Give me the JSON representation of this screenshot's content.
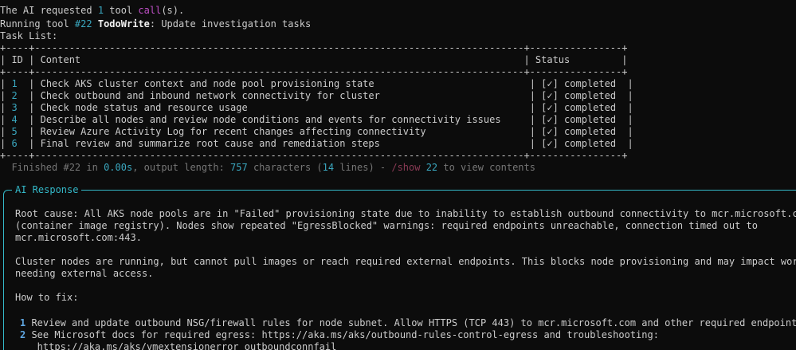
{
  "header": {
    "requested_prefix": "The AI requested ",
    "requested_count": "1",
    "requested_mid": " tool ",
    "requested_call": "call",
    "requested_suffix": "(s).",
    "running_prefix": "Running tool ",
    "running_id": "#22",
    "running_tool": "TodoWrite",
    "running_suffix": ": Update investigation tasks",
    "task_list_label": "Task List:"
  },
  "table": {
    "border_top": "+----+-------------------------------------------------------------------------------------+----------------+",
    "header_row": "| ID | Content                                                                             | Status         |",
    "border_mid": "+----+-------------------------------------------------------------------------------------+----------------+",
    "border_bottom": "+----+-------------------------------------------------------------------------------------+----------------+",
    "rows": [
      {
        "id": "1",
        "content": "Check AKS cluster context and node pool provisioning state",
        "status": "[✓] completed"
      },
      {
        "id": "2",
        "content": "Check outbound and inbound network connectivity for cluster",
        "status": "[✓] completed"
      },
      {
        "id": "3",
        "content": "Check node status and resource usage",
        "status": "[✓] completed"
      },
      {
        "id": "4",
        "content": "Describe all nodes and review node conditions and events for connectivity issues",
        "status": "[✓] completed"
      },
      {
        "id": "5",
        "content": "Review Azure Activity Log for recent changes affecting connectivity",
        "status": "[✓] completed"
      },
      {
        "id": "6",
        "content": "Final review and summarize root cause and remediation steps",
        "status": "[✓] completed"
      }
    ]
  },
  "finished": {
    "prefix": "  Finished ",
    "id": "#22",
    "in": " in ",
    "time": "0.00s",
    "output": ", output length: ",
    "length": "757",
    "characters": " characters (",
    "lines": "14",
    "lines_suffix": " lines) - ",
    "show_cmd": "/show",
    "show_num": " 22",
    "view": " to view contents"
  },
  "response": {
    "title": "AI Response",
    "lines": [
      "Root cause: All AKS node pools are in \"Failed\" provisioning state due to inability to establish outbound connectivity to mcr.microsoft.com",
      "(container image registry). Nodes show repeated \"EgressBlocked\" warnings: required endpoints unreachable, connection timed out to",
      "mcr.microsoft.com:443.",
      "",
      "Cluster nodes are running, but cannot pull images or reach required external endpoints. This blocks node provisioning and may impact workloads",
      "needing external access.",
      "",
      "How to fix:",
      ""
    ],
    "fix_items": [
      {
        "num": "1",
        "text": " Review and update outbound NSG/firewall rules for node subnet. Allow HTTPS (TCP 443) to mcr.microsoft.com and other required endpoints."
      },
      {
        "num": "2",
        "text": " See Microsoft docs for required egress: https://aka.ms/aks/outbound-rules-control-egress and troubleshooting:"
      }
    ],
    "fix_continuation": "   https://aka.ms/aks/vmextensionerror_outboundconnfail"
  },
  "colors": {
    "background": "#0c0c0c",
    "text": "#cccccc",
    "accent_cyan": "#3aa7bf",
    "panel_border": "#34b9c9",
    "magenta": "#c050c8",
    "dim": "#767676"
  }
}
